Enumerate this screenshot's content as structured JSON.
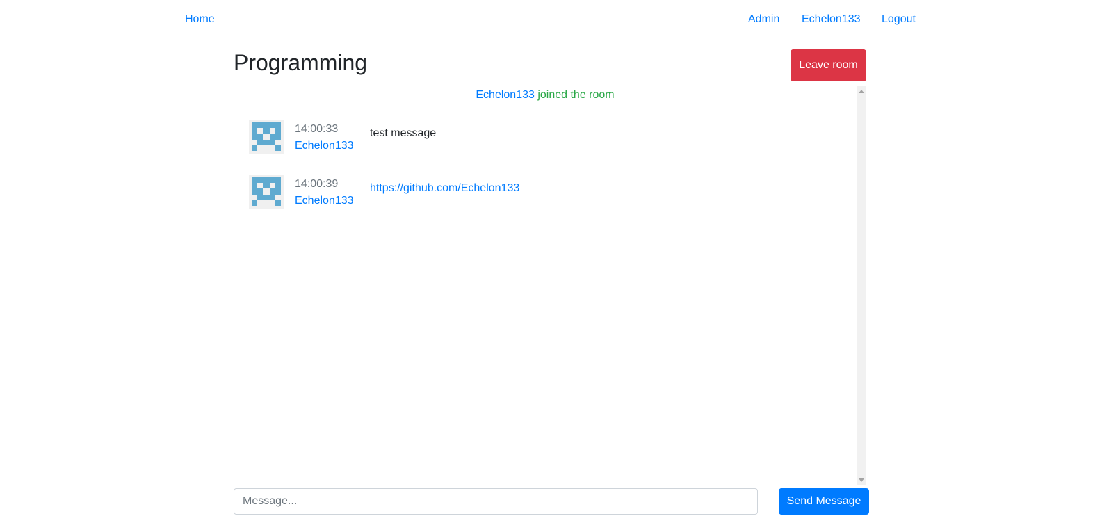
{
  "navbar": {
    "home": "Home",
    "admin": "Admin",
    "user": "Echelon133",
    "logout": "Logout"
  },
  "room": {
    "title": "Programming",
    "leave_label": "Leave room"
  },
  "events": {
    "join_user": "Echelon133",
    "join_text": " joined the room"
  },
  "messages": [
    {
      "time": "14:00:33",
      "author": "Echelon133",
      "text": "test message"
    },
    {
      "time": "14:00:39",
      "author": "Echelon133",
      "text": "https://github.com/Echelon133"
    }
  ],
  "composer": {
    "placeholder": "Message...",
    "send_label": "Send Message"
  },
  "colors": {
    "link": "#007bff",
    "danger": "#dc3545",
    "success": "#28a745",
    "avatar": "#5faad0"
  },
  "icons": {
    "avatar": "identicon-avatar-icon",
    "scroll_up": "scroll-up-arrow-icon",
    "scroll_down": "scroll-down-arrow-icon"
  }
}
